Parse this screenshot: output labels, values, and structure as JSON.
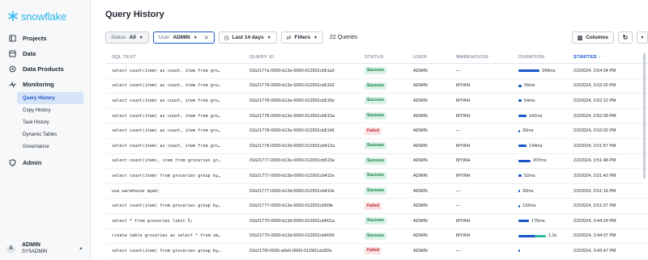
{
  "brand": "snowflake",
  "page_title": "Query History",
  "nav": [
    {
      "label": "Projects",
      "icon": "projects-icon"
    },
    {
      "label": "Data",
      "icon": "data-icon"
    },
    {
      "label": "Data Products",
      "icon": "data-products-icon"
    },
    {
      "label": "Monitoring",
      "icon": "monitoring-icon"
    }
  ],
  "monitoring_sub": [
    "Query History",
    "Copy History",
    "Task History",
    "Dynamic Tables",
    "Governance"
  ],
  "admin_label": "Admin",
  "user": {
    "initial": "A",
    "name": "ADMIN",
    "role": "SYSADMIN"
  },
  "filters": {
    "status_label": "Status",
    "status_value": "All",
    "user_label": "User",
    "user_value": "ADMIN",
    "range_value": "Last 14 days",
    "filters_label": "Filters",
    "queries_count": "22 Queries",
    "columns_label": "Columns"
  },
  "columns": [
    "SQL TEXT",
    "QUERY ID",
    "STATUS",
    "USER",
    "WAREHOUSE",
    "DURATION",
    "STARTED"
  ],
  "sort_indicator": "↓",
  "rows": [
    {
      "sql": "select count(item) as count, item from gro…",
      "id": "01b2177a-0000-b13e-0000-012901cb51a2",
      "status": "Success",
      "user": "ADMIN",
      "wh": "—",
      "dur": "349ms",
      "dur_frac": 0.75,
      "started": "2/2/2024, 3:54:34 PM"
    },
    {
      "sql": "select count(item) as count, item from gro…",
      "id": "01b21778-0000-b13e-0000-012901cb5162",
      "status": "Success",
      "user": "ADMIN",
      "wh": "MYWH",
      "dur": "56ms",
      "dur_frac": 0.12,
      "started": "2/2/2024, 3:52:20 PM"
    },
    {
      "sql": "select count(item) as count, item from gro…",
      "id": "01b21778-0000-b13e-0000-012901cb515e",
      "status": "Success",
      "user": "ADMIN",
      "wh": "MYWH",
      "dur": "54ms",
      "dur_frac": 0.12,
      "started": "2/2/2024, 3:52:12 PM"
    },
    {
      "sql": "select count(item) as count, item from gro…",
      "id": "01b21778-0000-b13e-0000-012901cb515a",
      "status": "Success",
      "user": "ADMIN",
      "wh": "MYWH",
      "dur": "141ms",
      "dur_frac": 0.3,
      "started": "2/2/2024, 3:52:09 PM"
    },
    {
      "sql": "select count(item) as count, item from gro…",
      "id": "01b21778-0000-b13e-0000-012901cb5146",
      "status": "Failed",
      "user": "ADMIN",
      "wh": "—",
      "dur": "20ms",
      "dur_frac": 0.05,
      "started": "2/2/2024, 3:52:02 PM"
    },
    {
      "sql": "select count(item) as count, item from gro…",
      "id": "01b21778-0000-b13d-0000-012901cb413a",
      "status": "Success",
      "user": "ADMIN",
      "wh": "MYWH",
      "dur": "134ms",
      "dur_frac": 0.29,
      "started": "2/2/2024, 3:51:57 PM"
    },
    {
      "sql": "select count(item), item from groceries gr…",
      "id": "01b21777-0000-b13e-0000-012901cb513a",
      "status": "Success",
      "user": "ADMIN",
      "wh": "MYWH",
      "dur": "207ms",
      "dur_frac": 0.44,
      "started": "2/2/2024, 3:51:48 PM"
    },
    {
      "sql": "select count(item) from groceries group by…",
      "id": "01b21777-0000-b13d-0000-012901cb412e",
      "status": "Success",
      "user": "ADMIN",
      "wh": "MYWH",
      "dur": "52ms",
      "dur_frac": 0.11,
      "started": "2/2/2024, 3:51:42 PM"
    },
    {
      "sql": "use warehouse mywh;",
      "id": "01b21777-0000-b13d-0000-012901cb410e",
      "status": "Success",
      "user": "ADMIN",
      "wh": "—",
      "dur": "32ms",
      "dur_frac": 0.07,
      "started": "2/2/2024, 3:51:16 PM"
    },
    {
      "sql": "select count(item) from groceries group by…",
      "id": "01b21777-0000-b13e-0000-012901cb50fe",
      "status": "Failed",
      "user": "ADMIN",
      "wh": "—",
      "dur": "132ms",
      "dur_frac": 0.07,
      "started": "2/2/2024, 3:51:07 PM"
    },
    {
      "sql": "select * from groceries limit 5;",
      "id": "01b21770-0000-b13d-0000-012901cb401a",
      "status": "Success",
      "user": "ADMIN",
      "wh": "MYWH",
      "dur": "175ms",
      "dur_frac": 0.37,
      "started": "2/2/2024, 3:44:29 PM"
    },
    {
      "sql": "create table groceries as select * from sm…",
      "id": "01b21770-0000-b13d-0000-012901cb4006",
      "status": "Success",
      "user": "ADMIN",
      "wh": "MYWH",
      "dur": "1.2s",
      "dur_frac": 1.0,
      "started": "2/2/2024, 3:44:07 PM"
    },
    {
      "sql": "select count(item) from groceries group by…",
      "id": "01b2176f-0000-a0e0-0000-012901cb3f2e",
      "status": "Failed",
      "user": "ADMIN",
      "wh": "—",
      "dur": "",
      "dur_frac": 0.0,
      "started": "2/2/2024, 3:43:47 PM"
    }
  ],
  "colors": {
    "accent": "#1a56c8",
    "brand": "#29b5e8",
    "duration_bar": "#1a56c8",
    "compile_bar": "#2eb8a0"
  }
}
